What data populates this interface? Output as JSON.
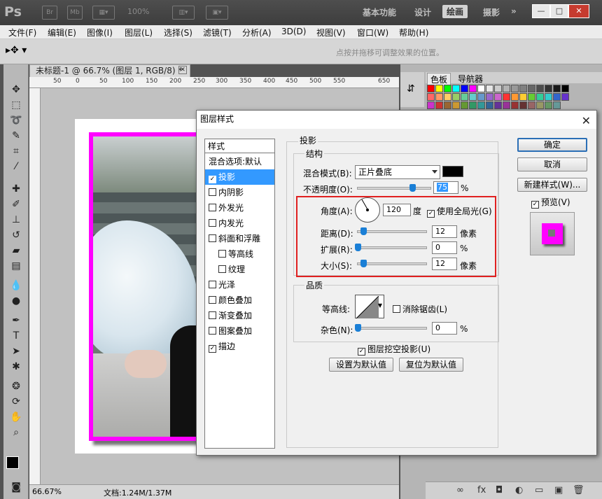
{
  "app": {
    "logo": "Ps",
    "icons": [
      "Br",
      "Mb"
    ],
    "zoom": "100%",
    "workspaces": [
      "基本功能",
      "设计",
      "绘画",
      "摄影"
    ],
    "workspace_more": "»",
    "window_controls": [
      "—",
      "□",
      "✕"
    ]
  },
  "menu": [
    "文件(F)",
    "编辑(E)",
    "图像(I)",
    "图层(L)",
    "选择(S)",
    "滤镜(T)",
    "分析(A)",
    "3D(D)",
    "视图(V)",
    "窗口(W)",
    "帮助(H)"
  ],
  "options": {
    "hint": "点按并拖移可调整效果的位置。"
  },
  "document": {
    "tab_title": "未标题-1 @ 66.7% (图层 1, RGB/8) *",
    "ruler_ticks": [
      "50",
      "0",
      "50",
      "100",
      "150",
      "200",
      "250",
      "300",
      "350",
      "400",
      "450",
      "500",
      "550",
      "650"
    ],
    "status_zoom": "66.67%",
    "status_doc": "文档:1.24M/1.37M"
  },
  "panels": {
    "tabs": [
      "色板",
      "导航器"
    ],
    "swatch_colors": [
      "#ff0000",
      "#ffff00",
      "#00ff00",
      "#00ffff",
      "#0000ff",
      "#ff00ff",
      "#ffffff",
      "#e6e6e6",
      "#cccccc",
      "#b3b3b3",
      "#999999",
      "#808080",
      "#666666",
      "#4d4d4d",
      "#333333",
      "#1a1a1a",
      "#000000",
      "#ff6666",
      "#ff9966",
      "#ffcc66",
      "#99cc66",
      "#66cc99",
      "#66cccc",
      "#6699cc",
      "#9966cc",
      "#cc66cc",
      "#ff3333",
      "#ff9933",
      "#ffcc33",
      "#66cc33",
      "#33cc99",
      "#33cccc",
      "#3366cc",
      "#6633cc",
      "#cc33cc",
      "#cc3333",
      "#996633",
      "#cc9933",
      "#669933",
      "#339966",
      "#339999",
      "#336699",
      "#663399",
      "#993399",
      "#993333",
      "#663333",
      "#996666",
      "#999966",
      "#669966",
      "#669999"
    ],
    "layer_icons": [
      "∞",
      "fx",
      "◘",
      "◐",
      "▭",
      "▣",
      "🗑"
    ]
  },
  "dialog": {
    "title": "图层样式",
    "close": "✕",
    "styles_header": "样式",
    "styles": [
      {
        "label": "混合选项:默认",
        "checkbox": false,
        "checked": false,
        "selected": false,
        "indent": false
      },
      {
        "label": "投影",
        "checkbox": true,
        "checked": true,
        "selected": true,
        "indent": false
      },
      {
        "label": "内阴影",
        "checkbox": true,
        "checked": false,
        "selected": false,
        "indent": false
      },
      {
        "label": "外发光",
        "checkbox": true,
        "checked": false,
        "selected": false,
        "indent": false
      },
      {
        "label": "内发光",
        "checkbox": true,
        "checked": false,
        "selected": false,
        "indent": false
      },
      {
        "label": "斜面和浮雕",
        "checkbox": true,
        "checked": false,
        "selected": false,
        "indent": false
      },
      {
        "label": "等高线",
        "checkbox": true,
        "checked": false,
        "selected": false,
        "indent": true
      },
      {
        "label": "纹理",
        "checkbox": true,
        "checked": false,
        "selected": false,
        "indent": true
      },
      {
        "label": "光泽",
        "checkbox": true,
        "checked": false,
        "selected": false,
        "indent": false
      },
      {
        "label": "颜色叠加",
        "checkbox": true,
        "checked": false,
        "selected": false,
        "indent": false
      },
      {
        "label": "渐变叠加",
        "checkbox": true,
        "checked": false,
        "selected": false,
        "indent": false
      },
      {
        "label": "图案叠加",
        "checkbox": true,
        "checked": false,
        "selected": false,
        "indent": false
      },
      {
        "label": "描边",
        "checkbox": true,
        "checked": true,
        "selected": false,
        "indent": false
      }
    ],
    "section_title": "投影",
    "structure": {
      "label": "结构",
      "blend_mode_label": "混合模式(B):",
      "blend_mode_value": "正片叠底",
      "shadow_color": "#000000",
      "opacity_label": "不透明度(O):",
      "opacity_value": "75",
      "opacity_unit": "%",
      "opacity_level": 0.75,
      "angle_label": "角度(A):",
      "angle_value": "120",
      "angle_unit": "度",
      "global_light_label": "使用全局光(G)",
      "global_light_checked": true,
      "distance_label": "距离(D):",
      "distance_value": "12",
      "distance_unit": "像素",
      "distance_level": 0.08,
      "spread_label": "扩展(R):",
      "spread_value": "0",
      "spread_unit": "%",
      "spread_level": 0.0,
      "size_label": "大小(S):",
      "size_value": "12",
      "size_unit": "像素",
      "size_level": 0.08
    },
    "quality": {
      "label": "品质",
      "contour_label": "等高线:",
      "antialias_label": "消除锯齿(L)",
      "antialias_checked": false,
      "noise_label": "杂色(N):",
      "noise_value": "0",
      "noise_unit": "%",
      "noise_level": 0.0
    },
    "knockout_label": "图层挖空投影(U)",
    "knockout_checked": true,
    "make_default": "设置为默认值",
    "reset_default": "复位为默认值",
    "ok": "确定",
    "cancel": "取消",
    "new_style": "新建样式(W)...",
    "preview_label": "预览(V)",
    "preview_checked": true,
    "accent_color": "#ff00ff"
  }
}
